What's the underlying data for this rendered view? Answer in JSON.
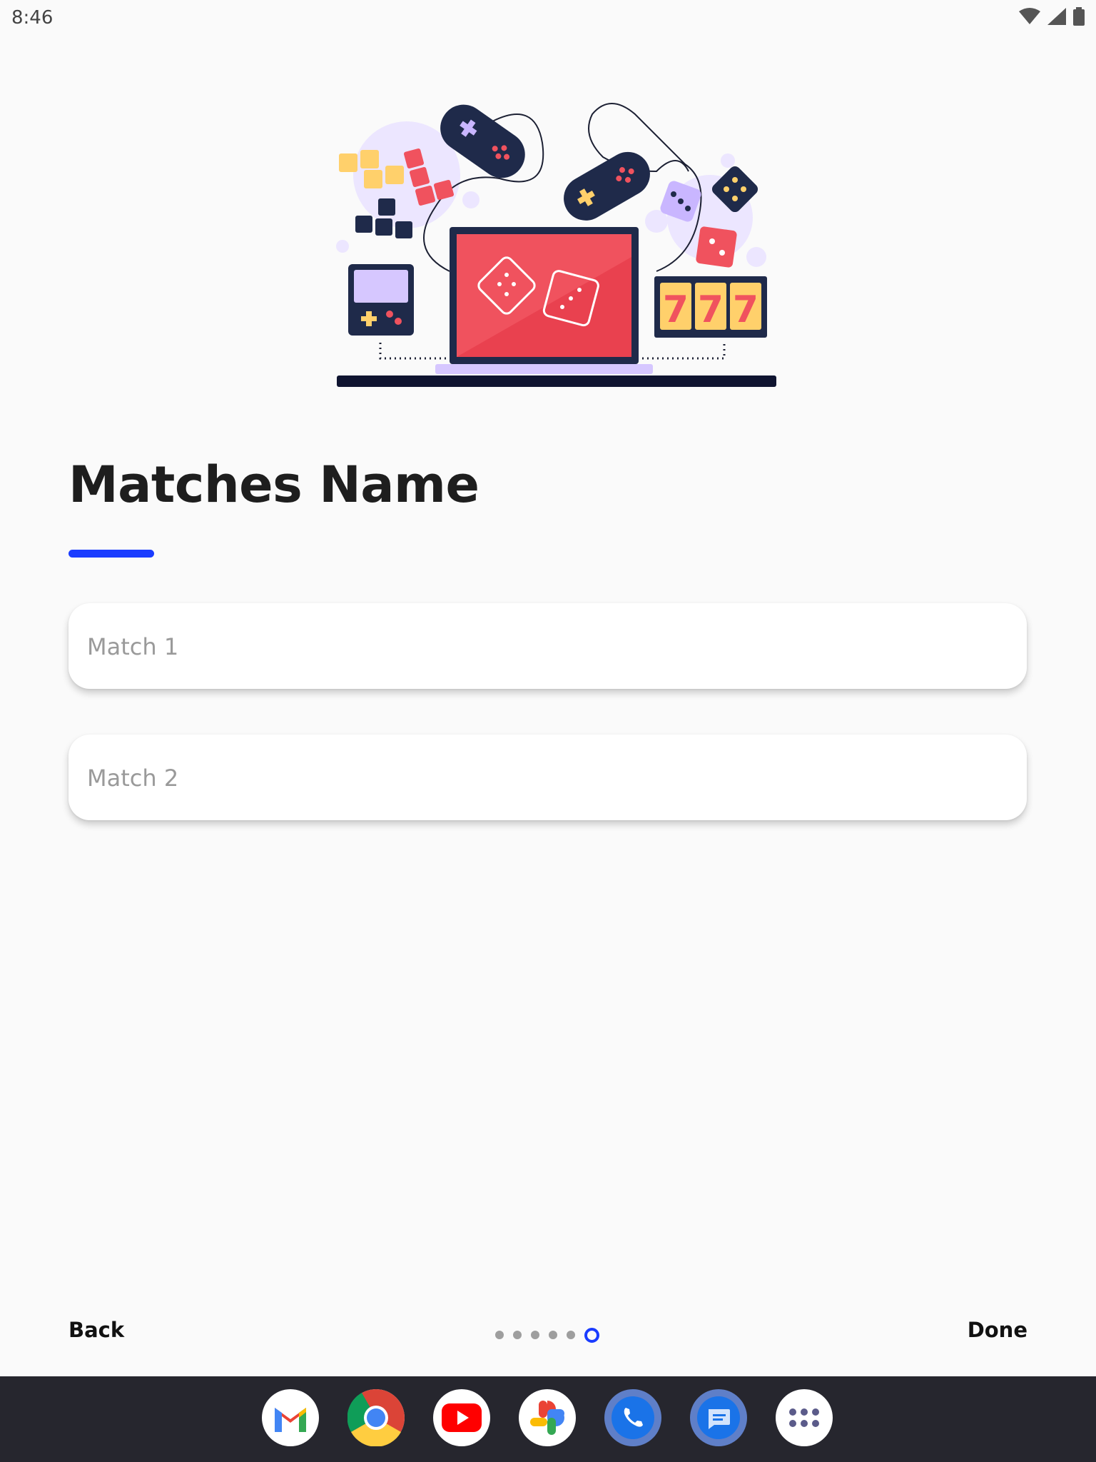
{
  "status_bar": {
    "time": "8:46"
  },
  "page": {
    "title": "Matches Name",
    "fields": [
      {
        "placeholder": "Match 1",
        "value": ""
      },
      {
        "placeholder": "Match 2",
        "value": ""
      }
    ]
  },
  "footer": {
    "back_label": "Back",
    "done_label": "Done",
    "page_count": 6,
    "current_page": 6
  },
  "dock": {
    "apps": [
      "gmail-icon",
      "chrome-icon",
      "youtube-icon",
      "photos-icon",
      "phone-icon",
      "messages-icon",
      "app-drawer-icon"
    ]
  },
  "colors": {
    "accent": "#1a3cff",
    "background": "#fafafa",
    "dock": "#26262e"
  }
}
